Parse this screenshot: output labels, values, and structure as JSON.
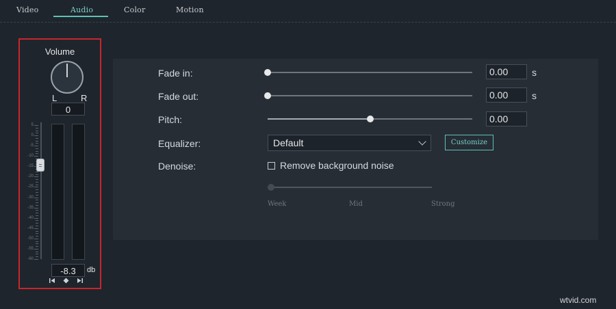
{
  "tabs": [
    {
      "label": "Video"
    },
    {
      "label": "Audio"
    },
    {
      "label": "Color"
    },
    {
      "label": "Motion"
    }
  ],
  "active_tab": "Audio",
  "accent_color": "#5ec1b6",
  "volume_panel": {
    "title": "Volume",
    "balance_left": "L",
    "balance_right": "R",
    "balance_value": "0",
    "scale_labels": [
      "5",
      "0",
      "-5",
      "-10",
      "-15",
      "-20",
      "-25",
      "-30",
      "-35",
      "-40",
      "-45",
      "-50",
      "-55",
      "-60"
    ],
    "volume_value": "-8.3",
    "volume_unit": "db",
    "controls": [
      "previous-icon",
      "reset-icon",
      "next-icon"
    ]
  },
  "settings": {
    "fade_in": {
      "label": "Fade in:",
      "value": "0.00",
      "unit": "s",
      "level": 0.0
    },
    "fade_out": {
      "label": "Fade out:",
      "value": "0.00",
      "unit": "s",
      "level": 0.0
    },
    "pitch": {
      "label": "Pitch:",
      "value": "0.00",
      "level": 0.5
    },
    "equalizer": {
      "label": "Equalizer:",
      "selected": "Default",
      "customize_label": "Customize"
    },
    "denoise": {
      "label": "Denoise:",
      "checkbox_label": "Remove background noise",
      "checked": false,
      "levels": [
        "Week",
        "Mid",
        "Strong"
      ]
    }
  },
  "watermark": "wtvid.com"
}
